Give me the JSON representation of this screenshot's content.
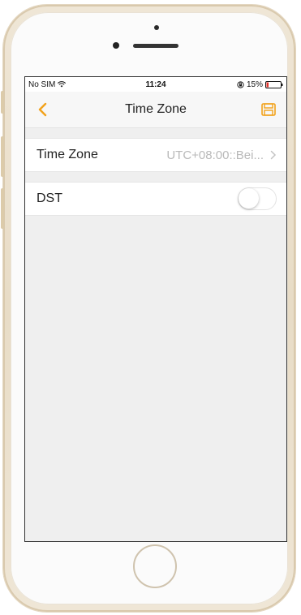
{
  "status_bar": {
    "carrier": "No SIM",
    "time": "11:24",
    "battery_percent": "15%",
    "battery_level": 0.15
  },
  "nav": {
    "title": "Time Zone",
    "back_icon": "chevron-left-icon",
    "save_icon": "save-icon"
  },
  "settings": {
    "timezone": {
      "label": "Time Zone",
      "value": "UTC+08:00::Bei..."
    },
    "dst": {
      "label": "DST",
      "enabled": false
    }
  },
  "colors": {
    "accent": "#f2a21b",
    "battery_low": "#e0302a"
  }
}
